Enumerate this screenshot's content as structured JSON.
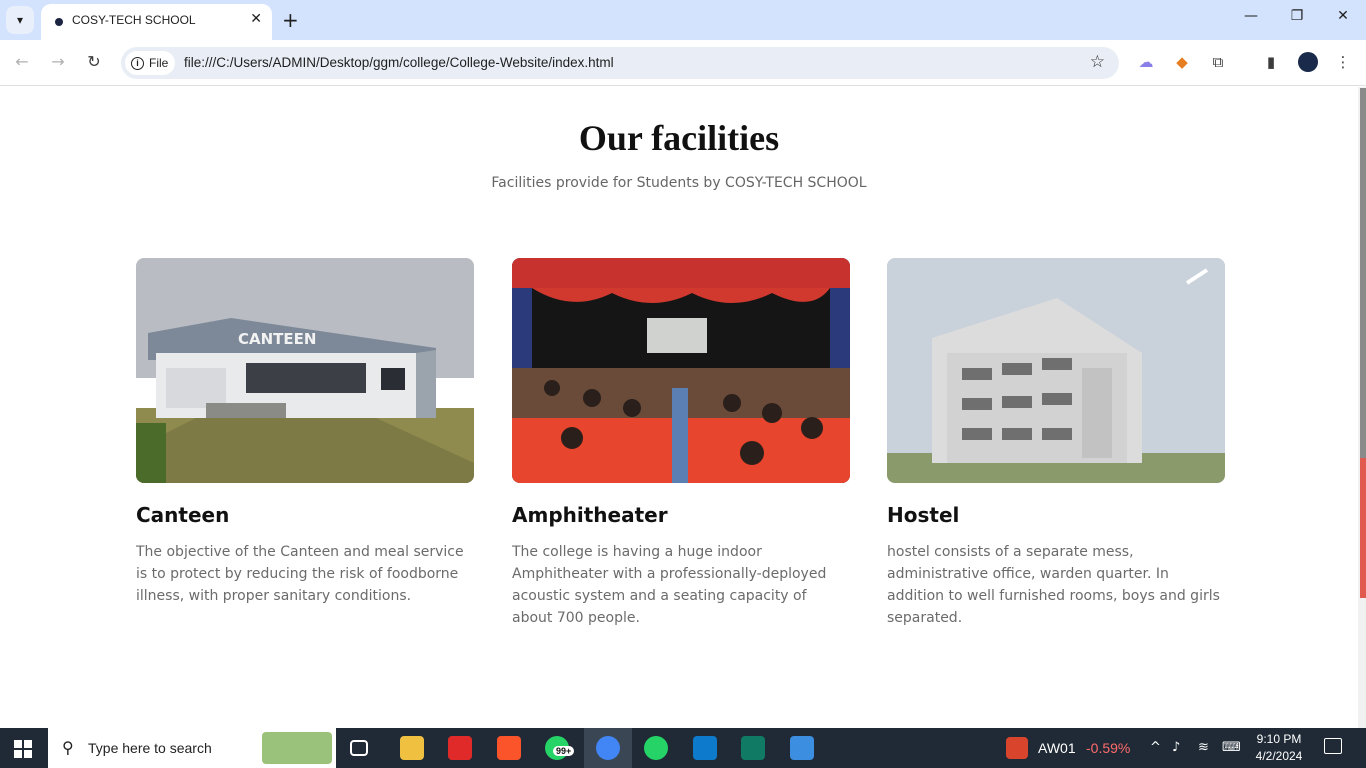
{
  "browser": {
    "tab_title": "COSY-TECH SCHOOL",
    "tab_close": "✕",
    "new_tab": "+",
    "chip_label": "File",
    "url": "file:///C:/Users/ADMIN/Desktop/ggm/college/College-Website/index.html",
    "window_controls": {
      "minimize": "—",
      "restore": "❐",
      "close": "✕"
    }
  },
  "section": {
    "title": "Our facilities",
    "subtitle": "Facilities provide for Students by COSY-TECH SCHOOL"
  },
  "cards": [
    {
      "title": "Canteen",
      "image_sign": "CANTEEN",
      "text": "The objective of the Canteen and meal service is to protect by reducing the risk of foodborne illness, with proper sanitary conditions."
    },
    {
      "title": "Amphitheater",
      "text": "The college is having a huge indoor Amphitheater with a professionally-deployed acoustic system and a seating capacity of about 700 people."
    },
    {
      "title": "Hostel",
      "text": "hostel consists of a separate mess, administrative office, warden quarter. In addition to well furnished rooms, boys and girls separated."
    }
  ],
  "taskbar": {
    "search_placeholder": "Type here to search",
    "whatsapp_badge": "99+",
    "stock_name": "AW01",
    "stock_change": "-0.59%",
    "time": "9:10 PM",
    "date": "4/2/2024"
  },
  "colors": {
    "tabbar": "#d3e3fd",
    "taskbar": "#1f2a36",
    "stock_negative": "#ff6b6b"
  }
}
